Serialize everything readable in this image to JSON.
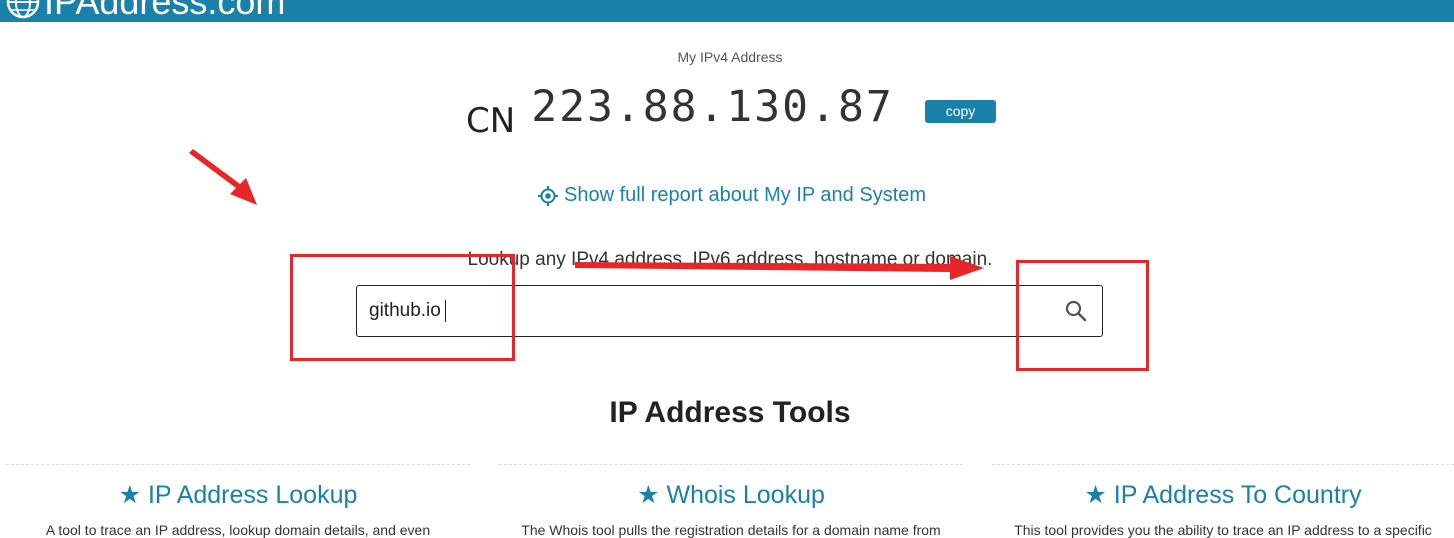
{
  "header": {
    "brand": "IPAddress.com",
    "brand_color": "#1a81aa"
  },
  "my_ip": {
    "label": "My IPv4 Address",
    "country": "CN",
    "address": "223.88.130.87",
    "copy_label": "copy"
  },
  "report_link": {
    "icon": "target-icon",
    "label": "Show full report about My IP and System"
  },
  "lookup": {
    "prompt": "Lookup any IPv4 address, IPv6 address, hostname or domain.",
    "input_value": "github.io",
    "search_icon": "search-icon"
  },
  "tools": {
    "title": "IP Address Tools",
    "items": [
      {
        "title": "★ IP Address Lookup",
        "desc": "A tool to trace an IP address, lookup domain details, and even"
      },
      {
        "title": "★ Whois Lookup",
        "desc": "The Whois tool pulls the registration details for a domain name from"
      },
      {
        "title": "★ IP Address To Country",
        "desc": "This tool provides you the ability to trace an IP address to a specific"
      }
    ]
  },
  "annotation_color": "#e8262a"
}
